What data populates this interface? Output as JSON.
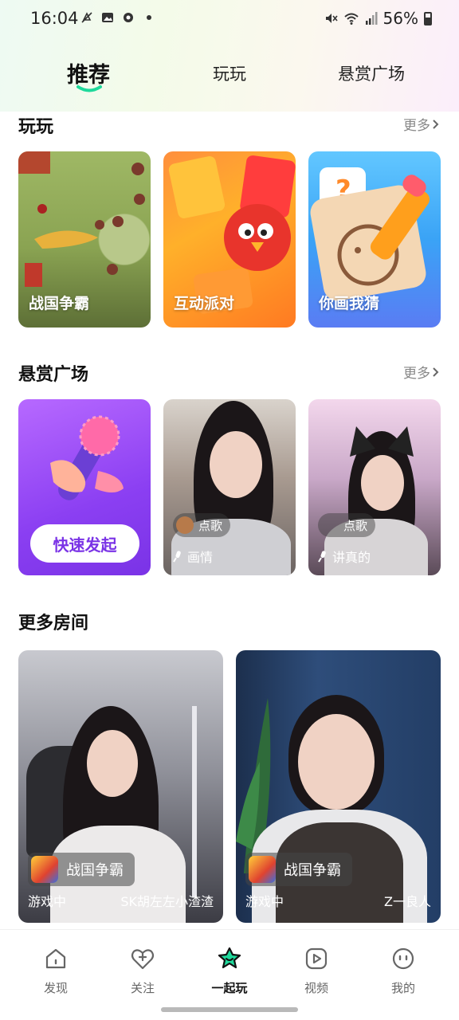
{
  "status_bar": {
    "time": "16:04",
    "battery": "56%"
  },
  "top_tabs": [
    {
      "label": "推荐",
      "active": true
    },
    {
      "label": "玩玩",
      "active": false
    },
    {
      "label": "悬赏广场",
      "active": false
    }
  ],
  "sections": {
    "play": {
      "title": "玩玩",
      "more": "更多"
    },
    "bounty": {
      "title": "悬赏广场",
      "more": "更多"
    },
    "rooms": {
      "title": "更多房间"
    }
  },
  "games": [
    {
      "label": "战国争霸"
    },
    {
      "label": "互动派对"
    },
    {
      "label": "你画我猜"
    }
  ],
  "bounty_cards": {
    "quick_start": "快速发起",
    "items": [
      {
        "tag": "点歌",
        "topic": "画情"
      },
      {
        "tag": "点歌",
        "topic": "讲真的"
      }
    ]
  },
  "rooms": [
    {
      "game": "战国争霸",
      "status": "游戏中",
      "host": "SK胡左左小渣渣"
    },
    {
      "game": "战国争霸",
      "status": "游戏中",
      "host": "Z一良人"
    }
  ],
  "bottom_nav": [
    {
      "label": "发现",
      "icon": "home-icon",
      "active": false
    },
    {
      "label": "关注",
      "icon": "heart-plus-icon",
      "active": false
    },
    {
      "label": "一起玩",
      "icon": "star-icon",
      "active": true
    },
    {
      "label": "视频",
      "icon": "play-icon",
      "active": false
    },
    {
      "label": "我的",
      "icon": "face-icon",
      "active": false
    }
  ],
  "colors": {
    "accent": "#1ed99b",
    "purple": "#7a33e6"
  }
}
